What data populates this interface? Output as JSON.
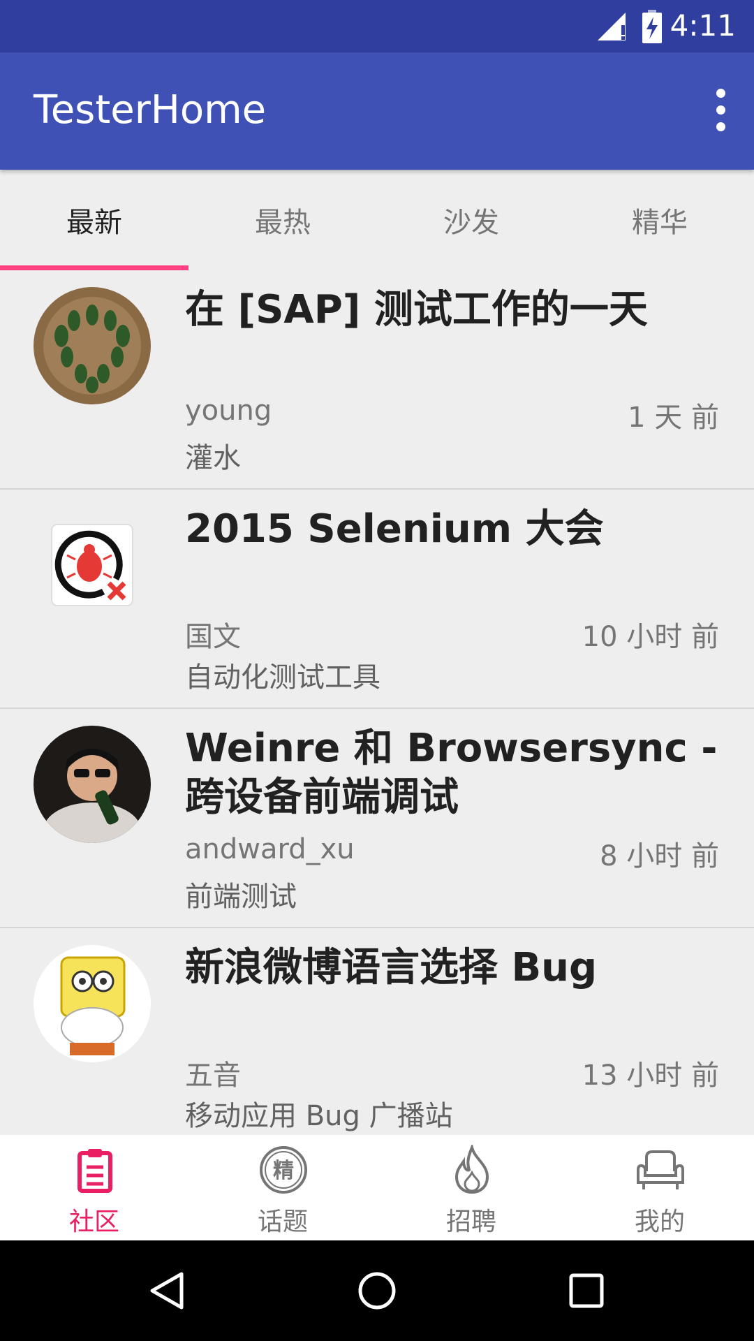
{
  "status_bar": {
    "time": "4:11"
  },
  "app_bar": {
    "title": "TesterHome",
    "menu_icon": "overflow-menu-icon"
  },
  "tabs": [
    {
      "label": "最新",
      "active": true
    },
    {
      "label": "最热",
      "active": false
    },
    {
      "label": "沙发",
      "active": false
    },
    {
      "label": "精华",
      "active": false
    }
  ],
  "posts": [
    {
      "title": "在 [SAP] 测试工作的一天",
      "author": "young",
      "time": "1 天 前",
      "node": "灌水"
    },
    {
      "title": "2015 Selenium 大会",
      "author": "国文",
      "time": "10 小时 前",
      "node": "自动化测试工具"
    },
    {
      "title": "Weinre 和 Browsersync - 跨设备前端调试",
      "author": "andward_xu",
      "time": "8 小时 前",
      "node": "前端测试"
    },
    {
      "title": "新浪微博语言选择 Bug",
      "author": "五音",
      "time": "13 小时 前",
      "node": "移动应用 Bug 广播站"
    }
  ],
  "bottom_nav": [
    {
      "label": "社区",
      "icon": "clipboard-icon",
      "active": true
    },
    {
      "label": "话题",
      "icon": "jing-badge-icon",
      "active": false
    },
    {
      "label": "招聘",
      "icon": "flame-icon",
      "active": false
    },
    {
      "label": "我的",
      "icon": "sofa-icon",
      "active": false
    }
  ],
  "colors": {
    "primary": "#3f51b5",
    "primary_dark": "#303f9f",
    "accent": "#ff4081",
    "nav_active": "#e91e63"
  }
}
